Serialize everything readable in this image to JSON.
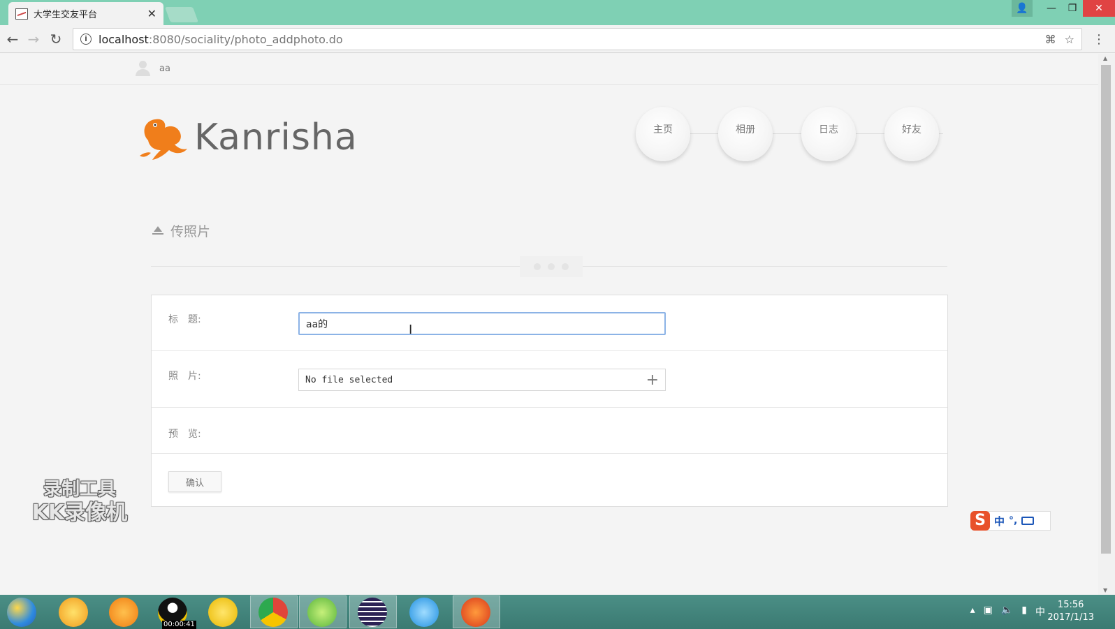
{
  "browser": {
    "tab_title": "大学生交友平台",
    "tab_close": "✕",
    "url_host": "localhost",
    "url_path": ":8080/sociality/photo_addphoto.do",
    "nav_back": "←",
    "nav_forward": "→",
    "nav_reload": "↻",
    "translate_icon": "⌘",
    "star_icon": "☆",
    "menu_icon": "⋮",
    "win_min": "—",
    "win_restore": "❐",
    "win_close": "✕",
    "profile_icon": "👤"
  },
  "page": {
    "username": "aa",
    "brand": "Kanrisha",
    "nav": [
      {
        "label": "主页"
      },
      {
        "label": "相册"
      },
      {
        "label": "日志"
      },
      {
        "label": "好友"
      }
    ],
    "section_title": "传照片",
    "form": {
      "title_label": "标　题:",
      "title_value": "aa的",
      "photo_label": "照　片:",
      "file_text": "No file selected",
      "file_plus": "+",
      "preview_label": "预　览:",
      "confirm_label": "确认"
    },
    "colors": {
      "accent": "#f07e1b",
      "titlebar": "#7fd0b4",
      "input_focus": "#8cb3e6"
    }
  },
  "overlay": {
    "watermark_line1": "录制工具",
    "watermark_line2": "KK录像机",
    "ime_logo": "S",
    "ime_lang": "中",
    "ime_punct": "°,"
  },
  "taskbar": {
    "timer": "00:00:41",
    "tray_lang": "中",
    "time": "15:56",
    "date": "2017/1/13"
  }
}
